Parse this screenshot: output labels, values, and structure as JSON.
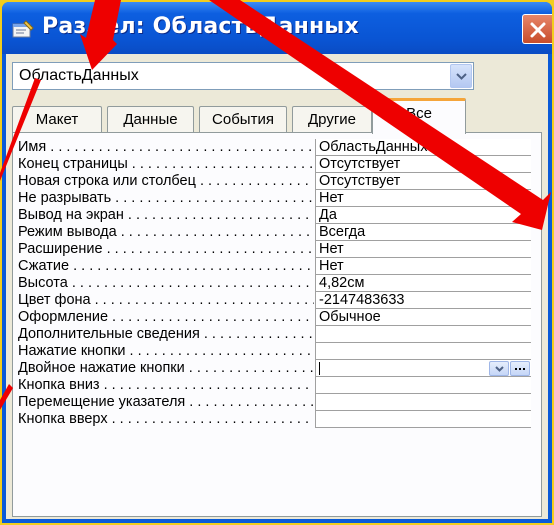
{
  "window": {
    "title": "Раздел: ОбластьДанных"
  },
  "selector": {
    "value": "ОбластьДанных"
  },
  "tabs": [
    {
      "label": "Макет",
      "active": false
    },
    {
      "label": "Данные",
      "active": false
    },
    {
      "label": "События",
      "active": false
    },
    {
      "label": "Другие",
      "active": false
    },
    {
      "label": "Все",
      "active": true
    }
  ],
  "properties": [
    {
      "name": "Имя",
      "value": "ОбластьДанных"
    },
    {
      "name": "Конец страницы",
      "value": "Отсутствует"
    },
    {
      "name": "Новая строка или столбец",
      "value": "Отсутствует"
    },
    {
      "name": "Не разрывать",
      "value": "Нет"
    },
    {
      "name": "Вывод на экран",
      "value": "Да"
    },
    {
      "name": "Режим вывода",
      "value": "Всегда"
    },
    {
      "name": "Расширение",
      "value": "Нет"
    },
    {
      "name": "Сжатие",
      "value": "Нет"
    },
    {
      "name": "Высота",
      "value": "4,82см"
    },
    {
      "name": "Цвет фона",
      "value": "-2147483633"
    },
    {
      "name": "Оформление",
      "value": "Обычное"
    },
    {
      "name": "Дополнительные сведения",
      "value": ""
    },
    {
      "name": "Нажатие кнопки",
      "value": ""
    },
    {
      "name": "Двойное нажатие кнопки",
      "value": ""
    },
    {
      "name": "Кнопка вниз",
      "value": ""
    },
    {
      "name": "Перемещение указателя",
      "value": ""
    },
    {
      "name": "Кнопка вверх",
      "value": ""
    }
  ],
  "colors": {
    "background": "#f2cd1d",
    "titlebar": "#0a5ad8",
    "active_tab_accent": "#f5a53a",
    "annotation_arrows": "#ee0000"
  },
  "icons": [
    "properties-icon",
    "close-icon",
    "dropdown-arrow-icon",
    "builder-ellipsis-icon"
  ]
}
